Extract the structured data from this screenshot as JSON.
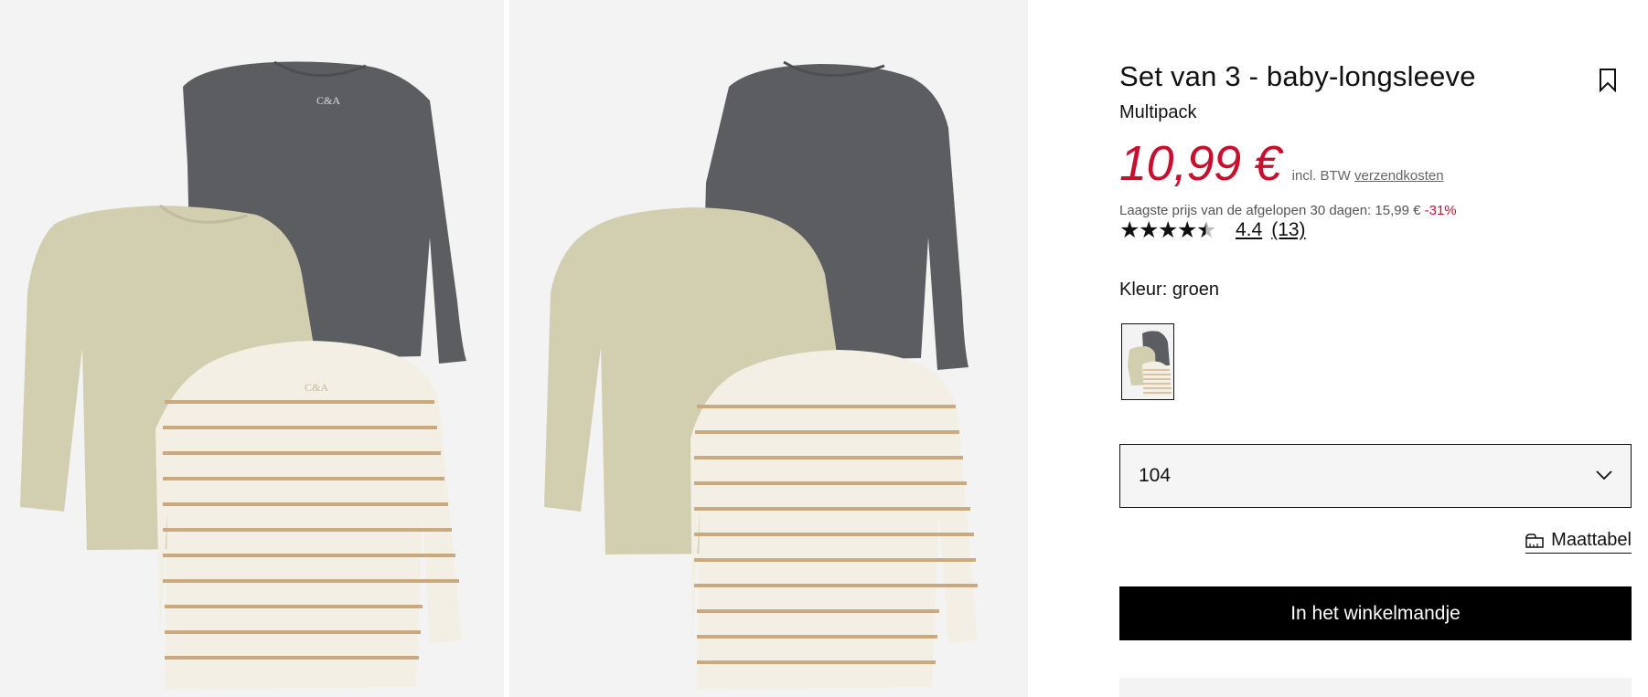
{
  "product": {
    "title": "Set van 3 - baby-longsleeve",
    "subtitle": "Multipack",
    "price": "10,99 €",
    "price_tax_text": "incl. BTW",
    "shipping_link": "verzendkosten",
    "lowest_price_text": "Laagste prijs van de afgelopen 30 dagen: 15,99 €",
    "discount_text": "-31%",
    "rating": 4.4,
    "rating_value": "4.4",
    "rating_count": "(13)",
    "color_label": "Kleur:",
    "color_value": "groen",
    "size_value": "104",
    "size_chart_label": "Maattabel",
    "add_to_cart_label": "In het winkelmandje"
  },
  "colors": {
    "price": "#c8102e",
    "button_bg": "#000000",
    "image_bg": "#f3f3f4"
  },
  "icons": [
    "bookmark-icon",
    "chevron-down-icon",
    "ruler-icon",
    "star-icon"
  ]
}
